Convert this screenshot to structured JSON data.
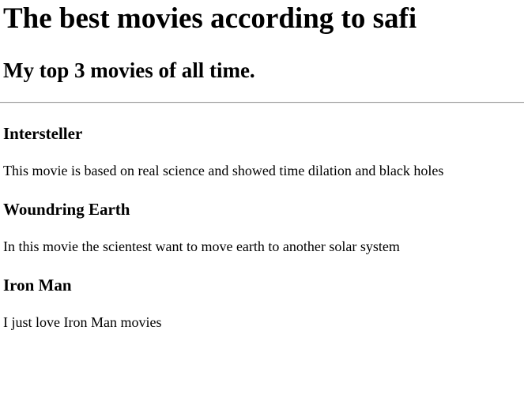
{
  "page": {
    "title": "The best movies according to safi",
    "subtitle": "My top 3 movies of all time."
  },
  "movies": [
    {
      "title": "Intersteller",
      "description": "This movie is based on real science and showed time dilation and black holes"
    },
    {
      "title": "Woundring Earth",
      "description": "In this movie the scientest want to move earth to another solar system"
    },
    {
      "title": "Iron Man",
      "description": "I just love Iron Man movies"
    }
  ]
}
